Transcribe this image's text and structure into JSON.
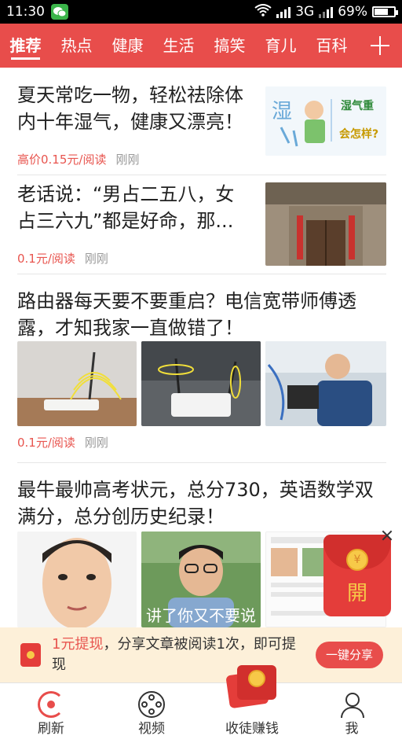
{
  "status_bar": {
    "time": "11:30",
    "network": "3G",
    "battery": "69%",
    "battery_level": 0.69
  },
  "tabs": [
    {
      "label": "推荐",
      "active": true
    },
    {
      "label": "热点"
    },
    {
      "label": "健康"
    },
    {
      "label": "生活"
    },
    {
      "label": "搞笑"
    },
    {
      "label": "育儿"
    },
    {
      "label": "百科"
    }
  ],
  "articles": [
    {
      "title": "夏天常吃一物，轻松祛除体内十年湿气，健康又漂亮！",
      "price": "高价0.15元/阅读",
      "time": "刚刚",
      "thumb_text": [
        "湿气重",
        "会怎样?"
      ]
    },
    {
      "title": "老话说：“男占二五八，女占三六九”都是好命，那...",
      "price": "0.1元/阅读",
      "time": "刚刚"
    },
    {
      "title": "路由器每天要不要重启？电信宽带师傅透露，才知我家一直做错了！",
      "price": "0.1元/阅读",
      "time": "刚刚"
    },
    {
      "title": "最牛最帅高考状元，总分730，英语数学双满分，总分创历史纪录！",
      "caption": "讲了你又不要说"
    }
  ],
  "promo": {
    "highlight": "1元提现",
    "text": "，分享文章被阅读1次，即可提现",
    "share_button": "一键分享"
  },
  "red_packet": {
    "open_label": "開"
  },
  "bottom_nav": [
    {
      "label": "刷新",
      "icon": "refresh-icon"
    },
    {
      "label": "视频",
      "icon": "video-reel-icon"
    },
    {
      "label": "收徒赚钱",
      "icon": "red-packet-icon"
    },
    {
      "label": "我",
      "icon": "user-icon"
    }
  ],
  "colors": {
    "brand_red": "#e84d4b",
    "price_red": "#e8554f",
    "promo_bg": "#fdf0d9"
  }
}
